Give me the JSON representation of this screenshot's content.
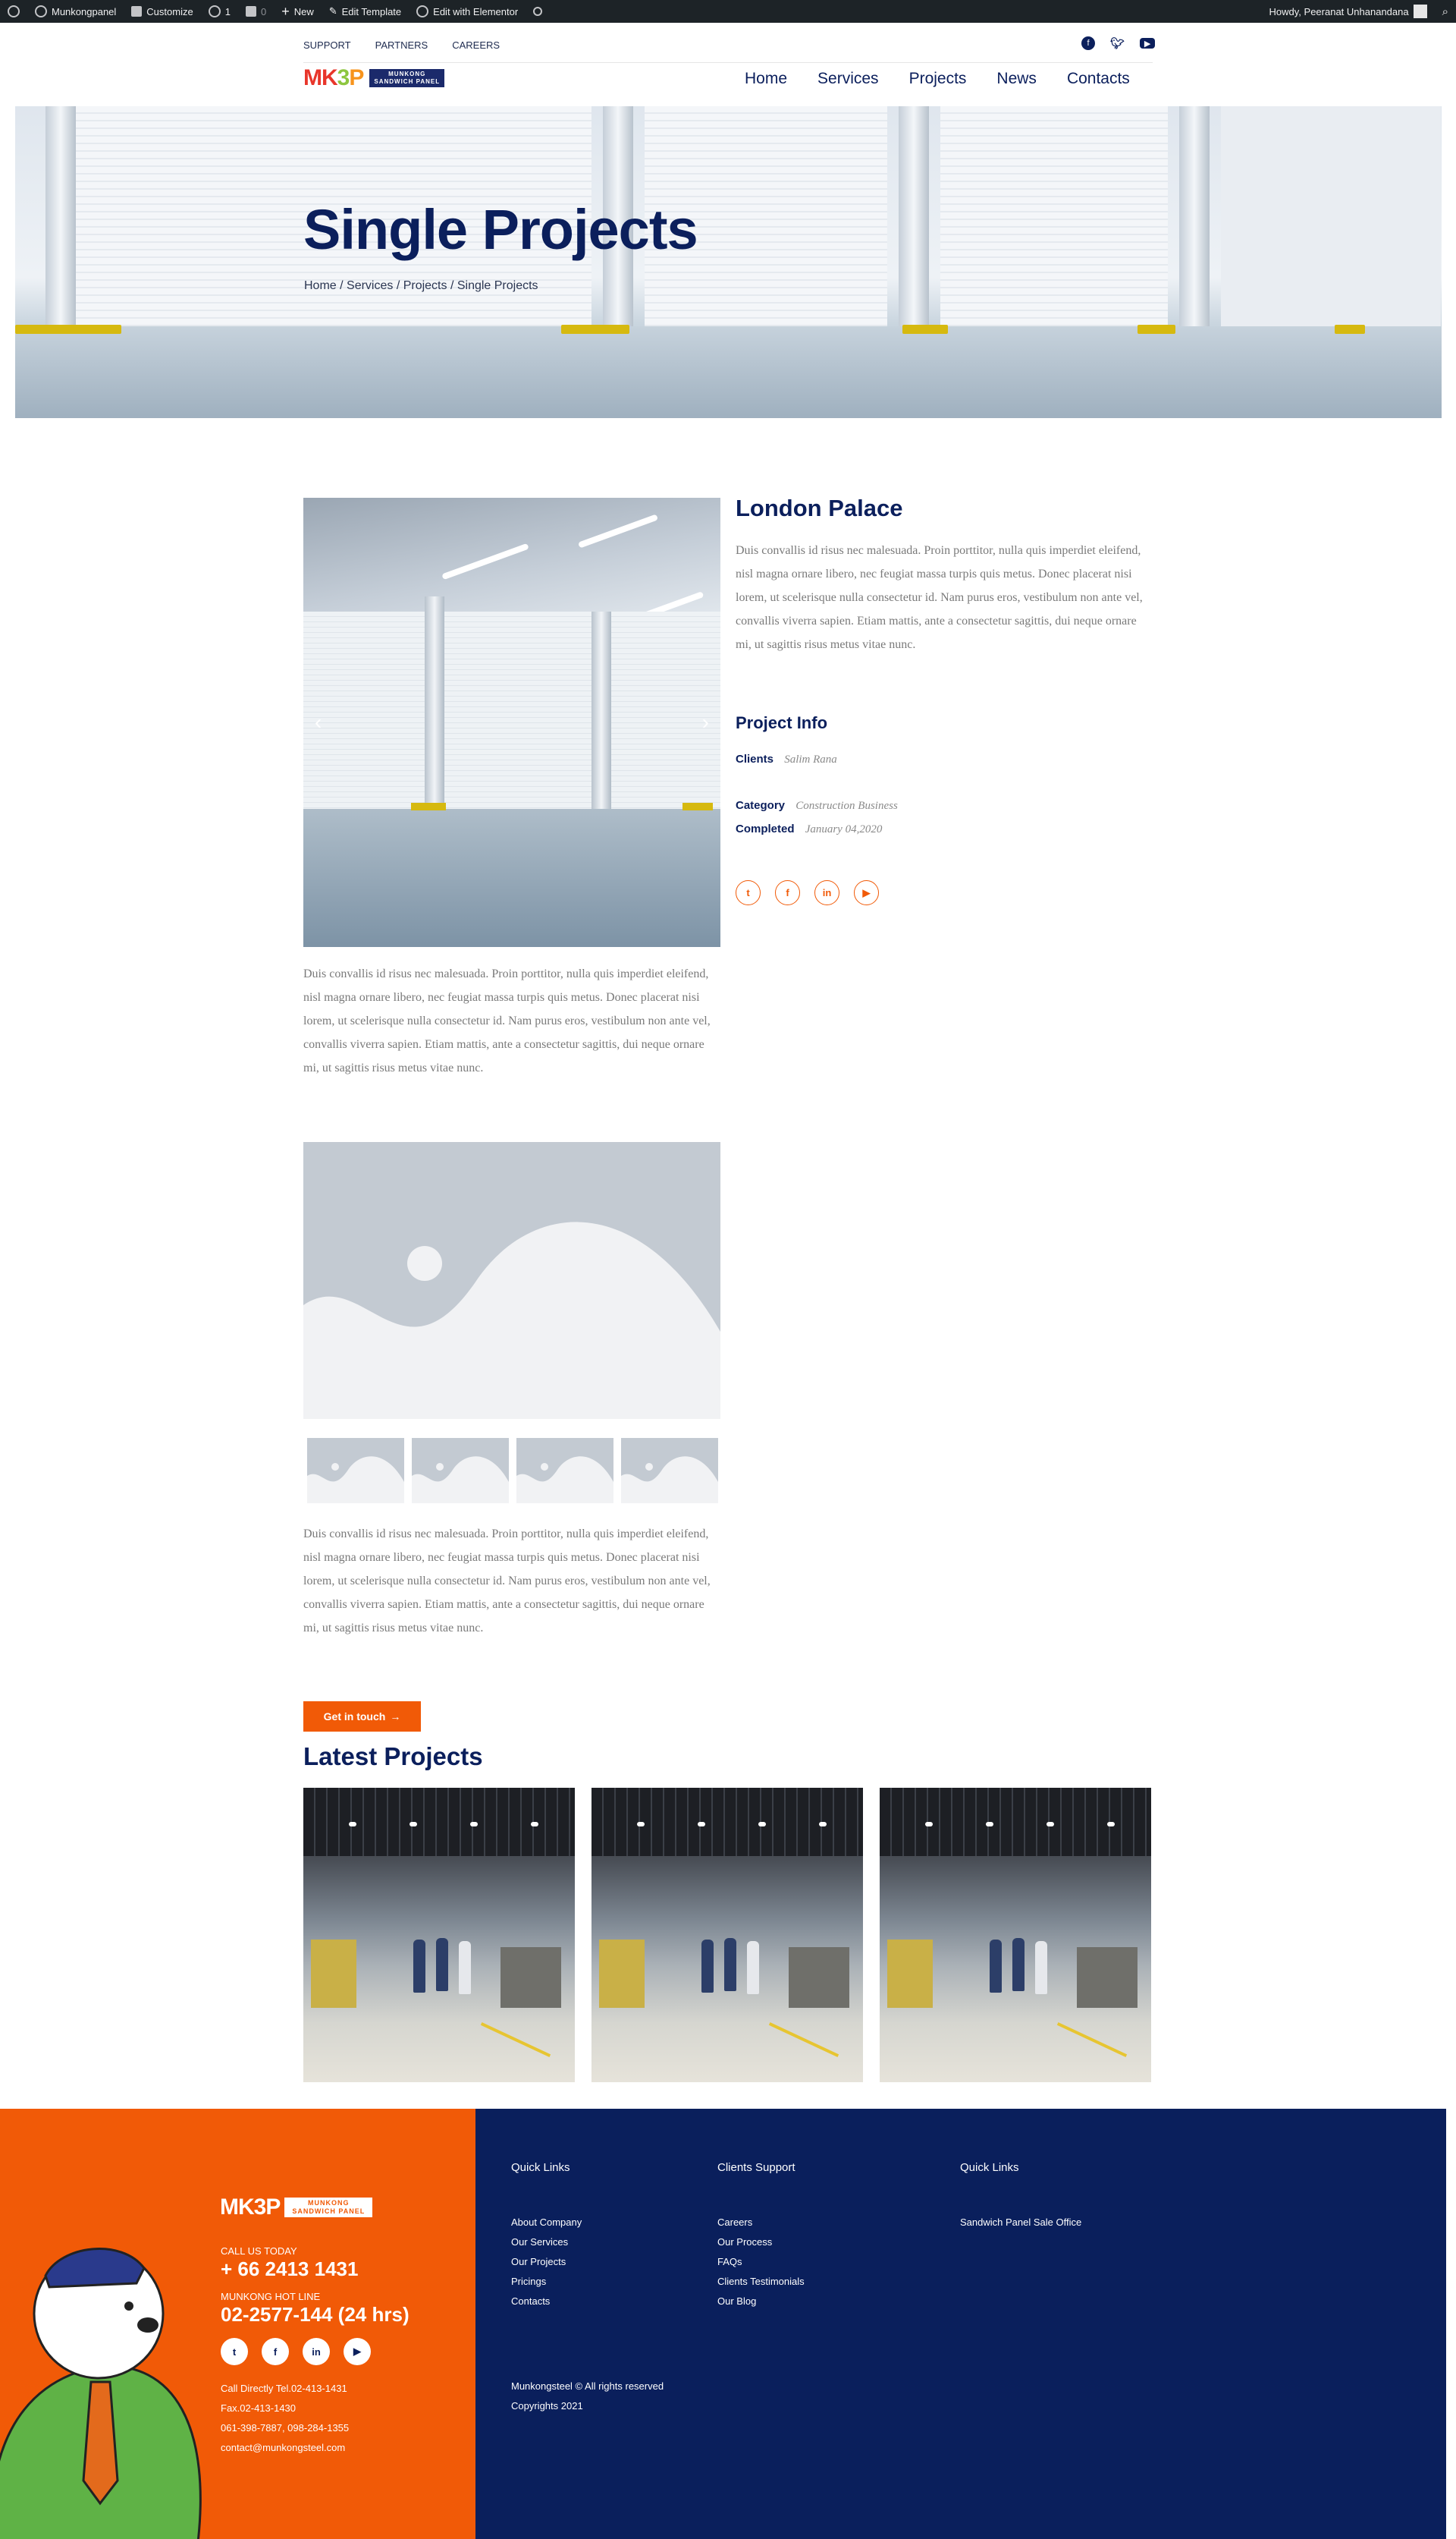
{
  "admin_bar": {
    "site_name": "Munkongpanel",
    "customize": "Customize",
    "updates_count": "1",
    "comments_count": "0",
    "new": "New",
    "edit_template": "Edit Template",
    "edit_elementor": "Edit with Elementor",
    "greeting": "Howdy, Peeranat Unhanandana"
  },
  "header": {
    "top_links": [
      "SUPPORT",
      "PARTNERS",
      "CAREERS"
    ],
    "social_icons": [
      "facebook-icon",
      "twitter-icon",
      "youtube-icon"
    ],
    "logo_text": "MK3P",
    "logo_tag_line1": "MUNKONG",
    "logo_tag_line2": "SANDWICH PANEL",
    "nav": [
      "Home",
      "Services",
      "Projects",
      "News",
      "Contacts"
    ]
  },
  "hero": {
    "title": "Single Projects",
    "breadcrumb": "Home / Services / Projects / Single Projects"
  },
  "project": {
    "title": "London Palace",
    "description": "Duis convallis id risus nec malesuada. Proin porttitor, nulla quis imperdiet eleifend, nisl magna ornare libero, nec feugiat massa turpis quis metus. Donec placerat nisi lorem, ut scelerisque nulla consectetur id. Nam purus eros, vestibulum non ante vel, convallis viverra sapien. Etiam mattis, ante a consectetur sagittis, dui neque ornare mi, ut sagittis risus metus vitae nunc.",
    "info_title": "Project Info",
    "clients_label": "Clients",
    "clients_value": "Salim Rana",
    "category_label": "Category",
    "category_value": "Construction Business",
    "completed_label": "Completed",
    "completed_value": "January 04,2020",
    "share_icons": [
      "twitter-icon",
      "facebook-icon",
      "linkedin-icon",
      "youtube-icon"
    ],
    "slider_prev": "‹",
    "slider_next": "›"
  },
  "content": {
    "paragraph_1": "Duis convallis id risus nec malesuada. Proin porttitor, nulla quis imperdiet eleifend, nisl magna ornare libero, nec feugiat massa turpis quis metus. Donec placerat nisi lorem, ut scelerisque nulla consectetur id. Nam purus eros, vestibulum non ante vel, convallis viverra sapien. Etiam mattis, ante a consectetur sagittis, dui neque ornare mi, ut sagittis risus metus vitae nunc.",
    "paragraph_2": "Duis convallis id risus nec malesuada. Proin porttitor, nulla quis imperdiet eleifend, nisl magna ornare libero, nec feugiat massa turpis quis metus. Donec placerat nisi lorem, ut scelerisque nulla consectetur id. Nam purus eros, vestibulum non ante vel, convallis viverra sapien. Etiam mattis, ante a consectetur sagittis, dui neque ornare mi, ut sagittis risus metus vitae nunc.",
    "cta_label": "Get in touch",
    "cta_arrow": "→",
    "latest_title": "Latest Projects"
  },
  "footer": {
    "logo_text": "MK3P",
    "logo_tag_line1": "MUNKONG",
    "logo_tag_line2": "SANDWICH PANEL",
    "call_label": "CALL US TODAY",
    "call_number": "+ 66 2413 1431",
    "hotline_label": "MUNKONG HOT LINE",
    "hotline_number": "02-2577-144 (24 hrs)",
    "social_icons": [
      "twitter-icon",
      "facebook-icon",
      "linkedin-icon",
      "youtube-icon"
    ],
    "contact_lines": [
      "Call Directly Tel.02-413-1431",
      "Fax.02-413-1430",
      "061-398-7887, 098-284-1355",
      "contact@munkongsteel.com"
    ],
    "col1_title": "Quick Links",
    "col1_links": [
      "About Company",
      "Our Services",
      "Our Projects",
      "Pricings",
      "Contacts"
    ],
    "col2_title": "Clients Support",
    "col2_links": [
      "Careers",
      "Our Process",
      "FAQs",
      "Clients Testimonials",
      "Our Blog"
    ],
    "col3_title": "Quick Links",
    "col3_links": [
      "Sandwich Panel Sale Office"
    ],
    "copyright_1": "Munkongsteel © All rights reserved",
    "copyright_2": "Copyrights 2021"
  },
  "colors": {
    "navy": "#0b1f5c",
    "orange": "#f15a07",
    "admin_bar": "#1d2327"
  }
}
